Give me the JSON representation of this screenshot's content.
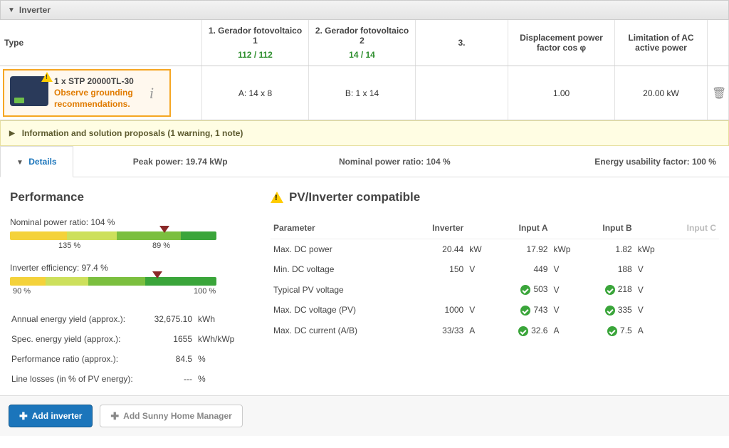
{
  "section": {
    "title": "Inverter"
  },
  "headers": {
    "type": "Type",
    "gen1": "1. Gerador fotovoltaico 1",
    "gen2": "2. Gerador fotovoltaico 2",
    "gen3": "3.",
    "disp": "Displacement power factor cos φ",
    "lim": "Limitation of AC active power",
    "ratio1": "112 / 112",
    "ratio2": "14 / 14"
  },
  "row": {
    "title": "1 x STP 20000TL-30",
    "note1": "Observe grounding",
    "note2": "recommendations.",
    "cfgA": "A: 14 x 8",
    "cfgB": "B: 1 x 14",
    "disp": "1.00",
    "lim": "20.00 kW"
  },
  "banner": {
    "text": "Information and solution proposals (1 warning, 1 note)"
  },
  "bar": {
    "tab": "Details",
    "peak": "Peak power: 19.74 kWp",
    "ratio": "Nominal power ratio: 104 %",
    "usab": "Energy usability factor: 100 %"
  },
  "perf": {
    "heading": "Performance",
    "npr_label": "Nominal power ratio: 104 %",
    "bar1_left": "135 %",
    "bar1_right": "89 %",
    "eff_label": "Inverter efficiency: 97.4 %",
    "bar2_left": "90 %",
    "bar2_right": "100 %",
    "rows": [
      {
        "k": "Annual energy yield (approx.):",
        "v": "32,675.10",
        "u": "kWh"
      },
      {
        "k": "Spec. energy yield (approx.):",
        "v": "1655",
        "u": "kWh/kWp"
      },
      {
        "k": "Performance ratio (approx.):",
        "v": "84.5",
        "u": "%"
      },
      {
        "k": "Line losses (in % of PV energy):",
        "v": "---",
        "u": "%"
      }
    ]
  },
  "compat": {
    "heading": "PV/Inverter compatible",
    "cols": {
      "param": "Parameter",
      "inv": "Inverter",
      "a": "Input A",
      "b": "Input B",
      "c": "Input C"
    },
    "rows": [
      {
        "p": "Max. DC power",
        "inv": "20.44",
        "inv_u": "kW",
        "a": "17.92",
        "a_u": "kWp",
        "a_ok": false,
        "b": "1.82",
        "b_u": "kWp",
        "b_ok": false
      },
      {
        "p": "Min. DC voltage",
        "inv": "150",
        "inv_u": "V",
        "a": "449",
        "a_u": "V",
        "a_ok": false,
        "b": "188",
        "b_u": "V",
        "b_ok": false
      },
      {
        "p": "Typical PV voltage",
        "inv": "",
        "inv_u": "",
        "a": "503",
        "a_u": "V",
        "a_ok": true,
        "b": "218",
        "b_u": "V",
        "b_ok": true
      },
      {
        "p": "Max. DC voltage (PV)",
        "inv": "1000",
        "inv_u": "V",
        "a": "743",
        "a_u": "V",
        "a_ok": true,
        "b": "335",
        "b_u": "V",
        "b_ok": true
      },
      {
        "p": "Max. DC current (A/B)",
        "inv": "33/33",
        "inv_u": "A",
        "a": "32.6",
        "a_u": "A",
        "a_ok": true,
        "b": "7.5",
        "b_u": "A",
        "b_ok": true
      }
    ]
  },
  "footer": {
    "add_inverter": "Add inverter",
    "add_shm": "Add Sunny Home Manager"
  }
}
